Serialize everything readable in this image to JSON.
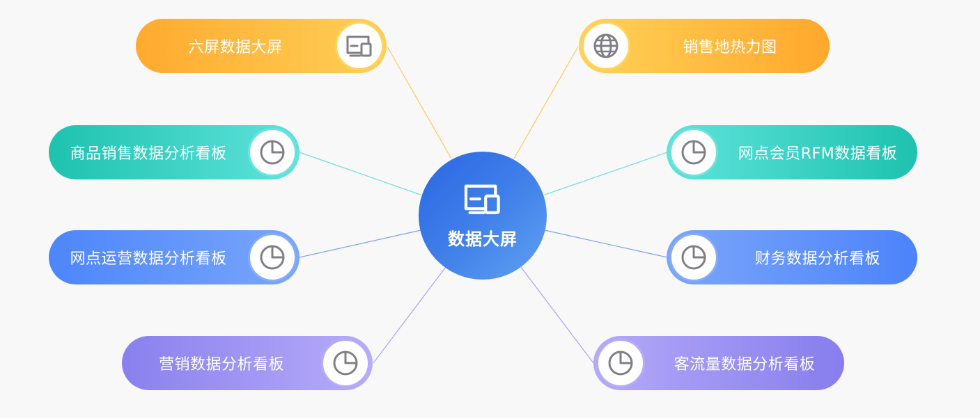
{
  "center": {
    "label": "数据大屏",
    "icon": "dashboard-screen-icon",
    "color": "#3a78e8"
  },
  "nodes": [
    {
      "id": "six-screen",
      "label": "六屏数据大屏",
      "icon": "dashboard-screen-icon",
      "color": "#ffb53e"
    },
    {
      "id": "product-sales",
      "label": "商品销售数据分析看板",
      "icon": "pie-chart-icon",
      "color": "#2ac7b3"
    },
    {
      "id": "outlet-operation",
      "label": "网点运营数据分析看板",
      "icon": "pie-chart-icon",
      "color": "#5a8ffb"
    },
    {
      "id": "marketing",
      "label": "营销数据分析看板",
      "icon": "pie-chart-icon",
      "color": "#9a90f3"
    },
    {
      "id": "sales-heatmap",
      "label": "销售地热力图",
      "icon": "globe-icon",
      "color": "#ffb53e"
    },
    {
      "id": "member-rfm",
      "label": "网点会员RFM数据看板",
      "icon": "pie-chart-icon",
      "color": "#2ac7b3"
    },
    {
      "id": "finance",
      "label": "财务数据分析看板",
      "icon": "pie-chart-icon",
      "color": "#5a8ffb"
    },
    {
      "id": "traffic",
      "label": "客流量数据分析看板",
      "icon": "pie-chart-icon",
      "color": "#9a90f3"
    }
  ]
}
